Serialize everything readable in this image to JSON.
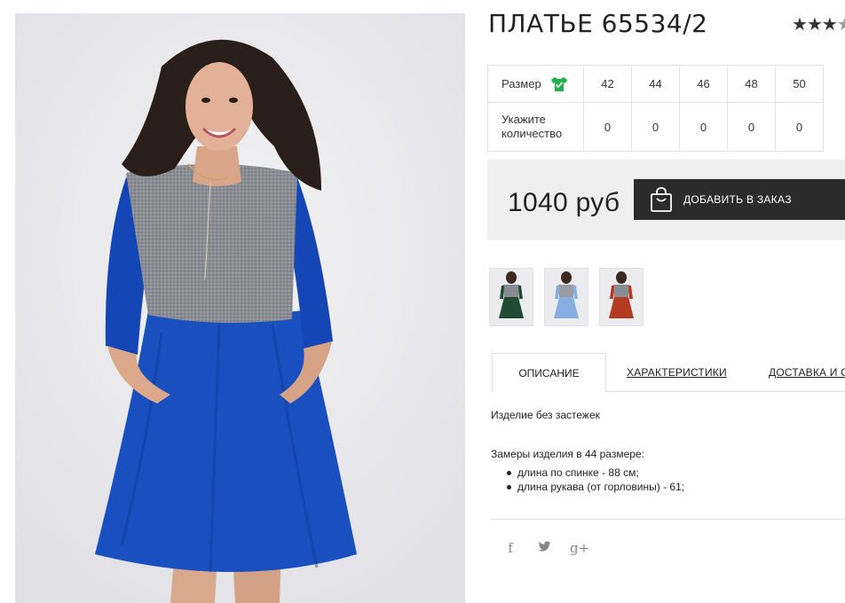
{
  "product": {
    "title": "ПЛАТЬЕ 65534/2",
    "rating_stars": 3,
    "rating_max": 4
  },
  "size_table": {
    "size_label": "Размер",
    "sizes": [
      "42",
      "44",
      "46",
      "48",
      "50"
    ],
    "quantity_label": "Укажите количество",
    "quantities": [
      "0",
      "0",
      "0",
      "0",
      "0"
    ]
  },
  "purchase": {
    "price": "1040 руб",
    "add_button_label": "ДОБАВИТЬ В ЗАКАЗ"
  },
  "thumbnails": [
    {
      "name": "thumb-green",
      "color": "#1f4a33"
    },
    {
      "name": "thumb-lightblue",
      "color": "#86aee0"
    },
    {
      "name": "thumb-red",
      "color": "#b53a22"
    }
  ],
  "tabs": {
    "description": "ОПИСАНИЕ",
    "characteristics": "ХАРАКТЕРИСТИКИ",
    "delivery": "ДОСТАВКА И О"
  },
  "description": {
    "text": "Изделие без застежек",
    "measures_title": "Замеры изделия в 44 размере:",
    "measures": [
      "длина по спинке - 88 см;",
      "длина рукава (от горловины) - 61;"
    ]
  },
  "social": {
    "facebook": "f",
    "twitter": "🐦",
    "gplus": "g+"
  },
  "colors": {
    "dress_blue": "#1a4fbf",
    "sleeve_blue": "#1447b5",
    "knit_gray": "#8a8c94",
    "button_dark": "#2b2b2b",
    "check_green": "#1fb24a"
  }
}
